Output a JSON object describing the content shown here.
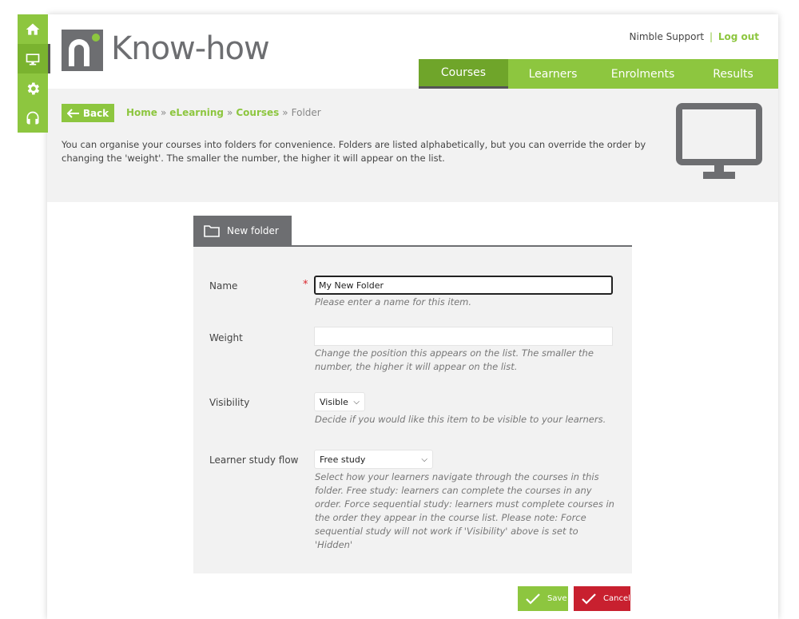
{
  "brand": {
    "name": "Know-how"
  },
  "rail": {
    "items": [
      "home-icon",
      "monitor-icon",
      "gear-icon",
      "headset-icon"
    ],
    "active_index": 1
  },
  "account": {
    "user": "Nimble Support",
    "separator": "|",
    "logout": "Log out"
  },
  "nav": {
    "tabs": [
      {
        "label": "Courses"
      },
      {
        "label": "Learners"
      },
      {
        "label": "Enrolments"
      },
      {
        "label": "Results"
      }
    ],
    "active_index": 0
  },
  "back_label": "Back",
  "breadcrumb": {
    "items": [
      "Home",
      "eLearning",
      "Courses"
    ],
    "separator": "»",
    "current": "Folder"
  },
  "intro_text": "You can organise your courses into folders for convenience. Folders are listed alphabetically, but you can override the order by changing the 'weight'. The smaller the number, the higher it will appear on the list.",
  "form": {
    "tab_label": "New folder",
    "name": {
      "label": "Name",
      "required_mark": "*",
      "value": "My New Folder",
      "help": "Please enter a name for this item."
    },
    "weight": {
      "label": "Weight",
      "value": "",
      "help": "Change the position this appears on the list. The smaller the number, the higher it will appear on the list."
    },
    "visibility": {
      "label": "Visibility",
      "value": "Visible",
      "help": "Decide if you would like this item to be visible to your learners."
    },
    "study_flow": {
      "label": "Learner study flow",
      "value": "Free study",
      "help": "Select how your learners navigate through the courses in this folder. Free study: learners can complete the courses in any order. Force sequential study: learners must complete courses in the order they appear in the course list. Please note: Force sequential study will not work if 'Visibility' above is set to 'Hidden'"
    }
  },
  "buttons": {
    "save": "Save",
    "cancel": "Cancel"
  },
  "colors": {
    "accent": "#8dc63f",
    "dark": "#6d6e71",
    "danger": "#c8202f",
    "panel": "#f2f2f2"
  }
}
